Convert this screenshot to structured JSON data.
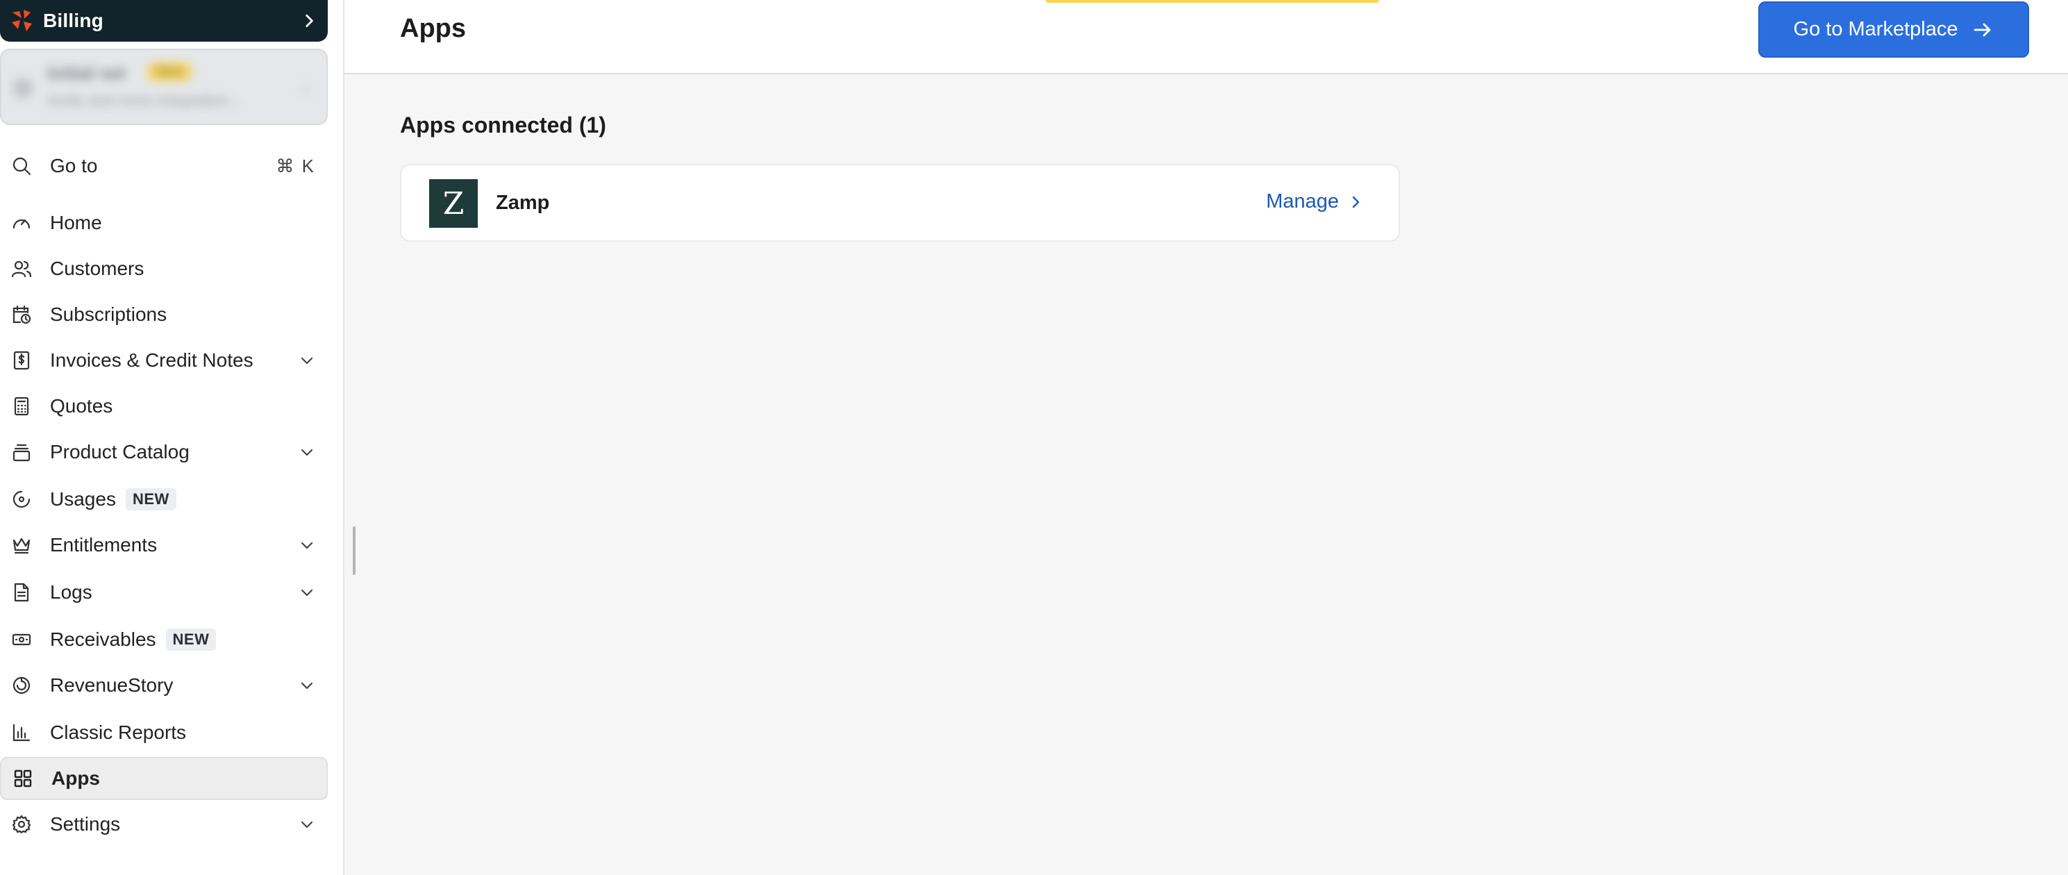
{
  "sidebar": {
    "product": "Billing",
    "brand_color": "#12242b",
    "promo": {
      "title": "Initial set",
      "badge": "New",
      "subtitle": "Invite and more integration..."
    },
    "goto": {
      "label": "Go to",
      "shortcut": "⌘ K"
    },
    "items": [
      {
        "label": "Home",
        "icon": "gauge-icon"
      },
      {
        "label": "Customers",
        "icon": "users-icon"
      },
      {
        "label": "Subscriptions",
        "icon": "calendar-clock-icon"
      },
      {
        "label": "Invoices & Credit Notes",
        "icon": "invoice-icon",
        "expandable": true
      },
      {
        "label": "Quotes",
        "icon": "calculator-icon"
      },
      {
        "label": "Product Catalog",
        "icon": "layers-icon",
        "expandable": true
      },
      {
        "label": "Usages",
        "icon": "target-icon",
        "badge": "NEW"
      },
      {
        "label": "Entitlements",
        "icon": "crown-icon",
        "expandable": true
      },
      {
        "label": "Logs",
        "icon": "document-icon",
        "expandable": true
      },
      {
        "label": "Receivables",
        "icon": "cash-icon",
        "badge": "NEW"
      },
      {
        "label": "RevenueStory",
        "icon": "chart-ring-icon",
        "expandable": true
      },
      {
        "label": "Classic Reports",
        "icon": "bar-chart-icon"
      },
      {
        "label": "Apps",
        "icon": "grid-icon",
        "active": true
      },
      {
        "label": "Settings",
        "icon": "gear-icon",
        "expandable": true
      }
    ]
  },
  "header": {
    "title": "Apps",
    "marketplace_button": "Go to Marketplace",
    "accent_color": "#2b6fdf"
  },
  "main": {
    "section_title": "Apps connected (1)",
    "apps": [
      {
        "logo_letter": "Z",
        "name": "Zamp",
        "action": "Manage"
      }
    ]
  }
}
